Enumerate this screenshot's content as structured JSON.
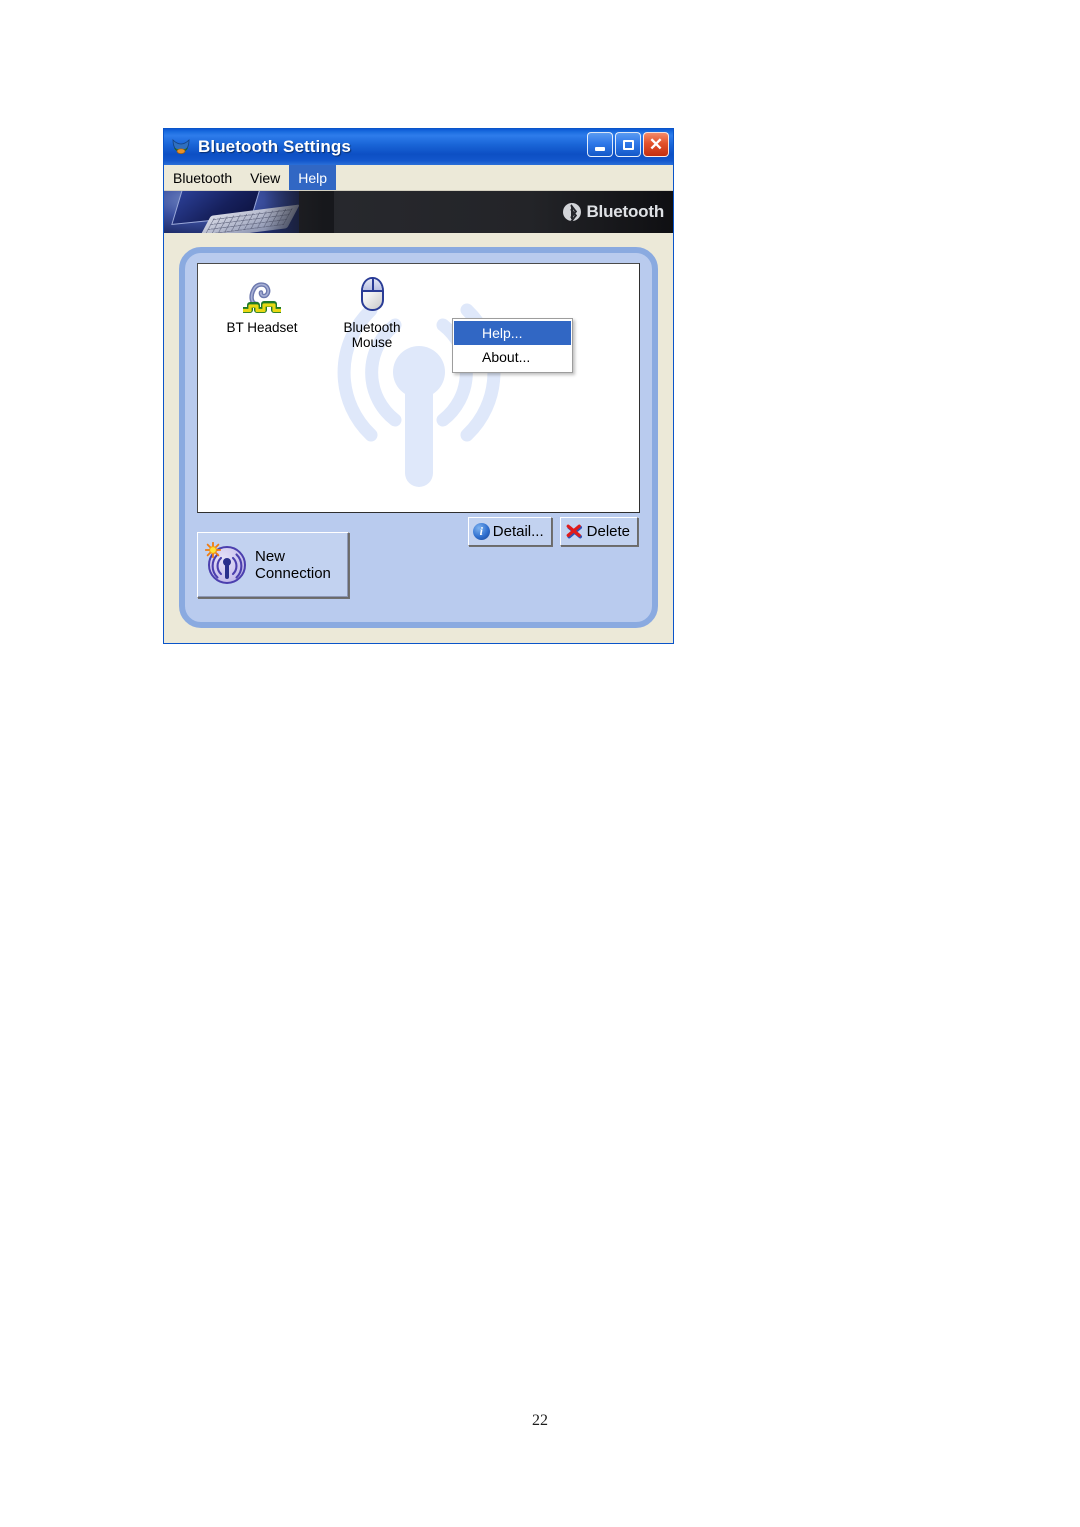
{
  "window": {
    "title": "Bluetooth Settings",
    "title_icon": "bluetooth-settings-app-icon",
    "controls": {
      "minimize": "minimize-button",
      "maximize": "maximize-button",
      "close": "close-button"
    }
  },
  "menubar": {
    "items": [
      {
        "label": "Bluetooth",
        "active": false
      },
      {
        "label": "View",
        "active": false
      },
      {
        "label": "Help",
        "active": true
      }
    ]
  },
  "dropdown": {
    "open_for": "Help",
    "items": [
      {
        "label": "Help...",
        "selected": true
      },
      {
        "label": "About...",
        "selected": false
      }
    ]
  },
  "banner": {
    "photo_alt": "laptop-photo",
    "logo_text": "Bluetooth",
    "logo_trademark": "®",
    "logo_icon": "bluetooth-logo-icon"
  },
  "device_list": {
    "watermark_icon": "antenna-signal-watermark",
    "devices": [
      {
        "name": "BT Headset",
        "icon": "bluetooth-headset-icon"
      },
      {
        "name": "Bluetooth\nMouse",
        "line1": "Bluetooth",
        "line2": "Mouse",
        "icon": "bluetooth-mouse-icon"
      }
    ]
  },
  "buttons": {
    "new_connection": {
      "line1": "New",
      "line2": "Connection",
      "icon": "new-connection-antenna-icon"
    },
    "detail": {
      "label": "Detail...",
      "icon": "info-icon"
    },
    "delete": {
      "label": "Delete",
      "icon": "red-x-icon"
    }
  },
  "page": {
    "number": "22"
  },
  "colors": {
    "titlebar_blue": "#1a66d8",
    "menu_highlight": "#3167c4",
    "window_bg": "#ece9d8",
    "panel_blue": "#b9cbee",
    "panel_border": "#8aaae0",
    "button_face": "#c2d2f0",
    "banner_dark": "#23242a"
  }
}
